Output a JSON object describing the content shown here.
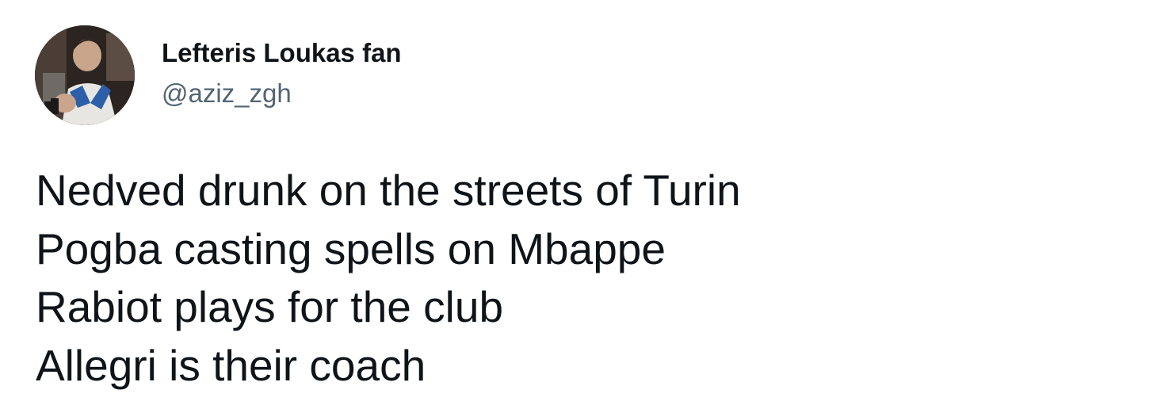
{
  "tweet": {
    "author": {
      "display_name": "Lefteris Loukas fan",
      "handle": "@aziz_zgh",
      "avatar_icon": "profile-photo"
    },
    "text_lines": [
      "Nedved drunk on the streets of Turin",
      "Pogba casting spells on Mbappe",
      "Rabiot plays for the club",
      "Allegri is their coach"
    ]
  },
  "colors": {
    "background": "#ffffff",
    "text_primary": "#0f1419",
    "text_secondary": "#536471"
  }
}
